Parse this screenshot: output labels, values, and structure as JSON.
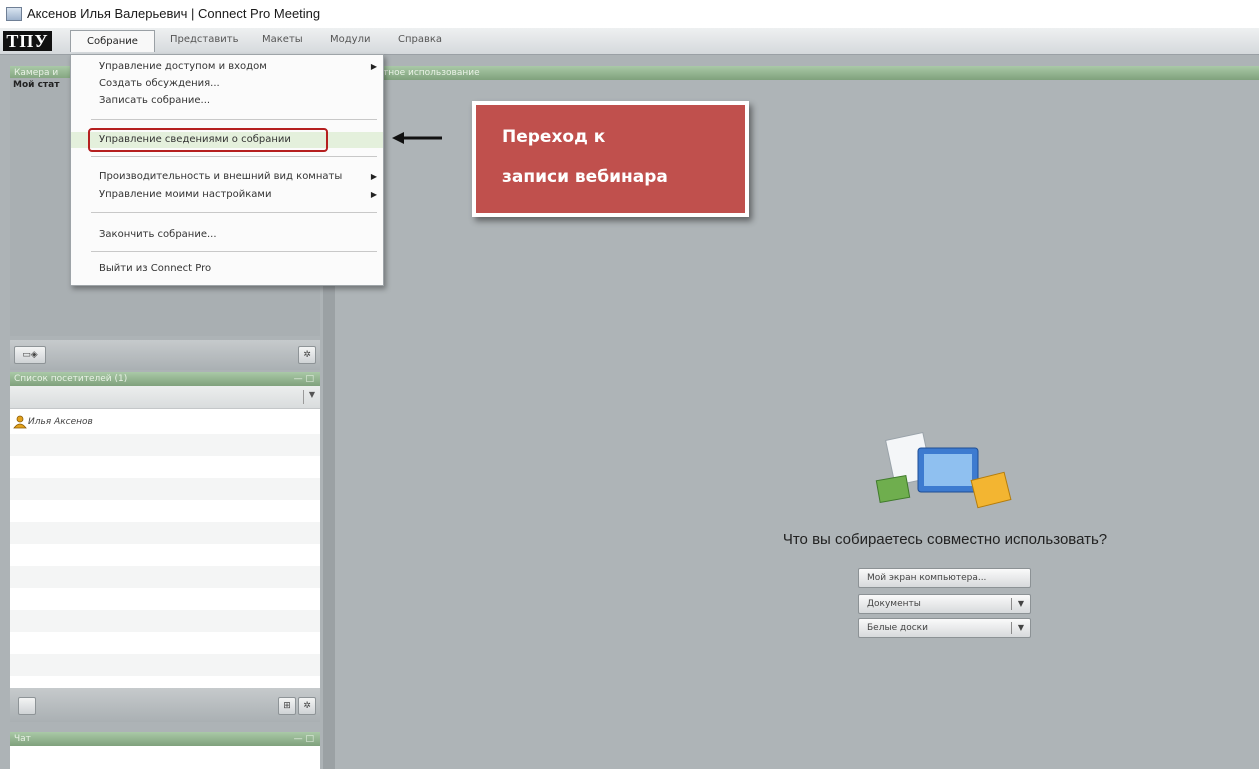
{
  "window": {
    "title": "Аксенов Илья Валерьевич | Connect Pro Meeting"
  },
  "logo": {
    "text": "ТПУ"
  },
  "menubar": {
    "items": [
      "Собрание",
      "Представить",
      "Макеты",
      "Модули",
      "Справка"
    ],
    "active": "Собрание"
  },
  "dropdown": {
    "items": [
      {
        "label": "Управление доступом и входом",
        "submenu": true
      },
      {
        "label": "Создать обсуждения...",
        "submenu": false
      },
      {
        "label": "Записать собрание...",
        "submenu": false
      },
      {
        "label": "Управление сведениями о собрании",
        "submenu": false,
        "highlighted": true
      },
      {
        "label": "Производительность и внешний вид комнаты",
        "submenu": true
      },
      {
        "label": "Управление моими настройками",
        "submenu": true
      },
      {
        "label": "Закончить собрание...",
        "submenu": false
      },
      {
        "label": "Выйти из Connect Pro",
        "submenu": false
      }
    ],
    "submenu_glyph": "▶"
  },
  "camera_panel": {
    "title": "Камера и",
    "status_label": "Мой стат"
  },
  "stage": {
    "header_fragment": "стное использование"
  },
  "attendees": {
    "title": "Список посетителей (1)",
    "names": [
      "Илья Аксенов"
    ]
  },
  "chat": {
    "title": "Чат"
  },
  "share": {
    "question": "Что вы собираетесь совместно использовать?",
    "buttons": [
      "Мой экран компьютера...",
      "Документы",
      "Белые доски"
    ],
    "dropdown_glyph": "▼"
  },
  "annotation": {
    "line1": "Переход к",
    "line2": "записи вебинара",
    "arrow_glyph": "⟵"
  },
  "panel_controls": {
    "min_max": "— □",
    "webcam_glyph": "▭◈",
    "settings_glyph": "✲",
    "layout_glyph": "⊞"
  },
  "colors": {
    "panel_header": "#8fb28c",
    "callout": "#c0504d",
    "highlight_border": "#b51f1f"
  }
}
